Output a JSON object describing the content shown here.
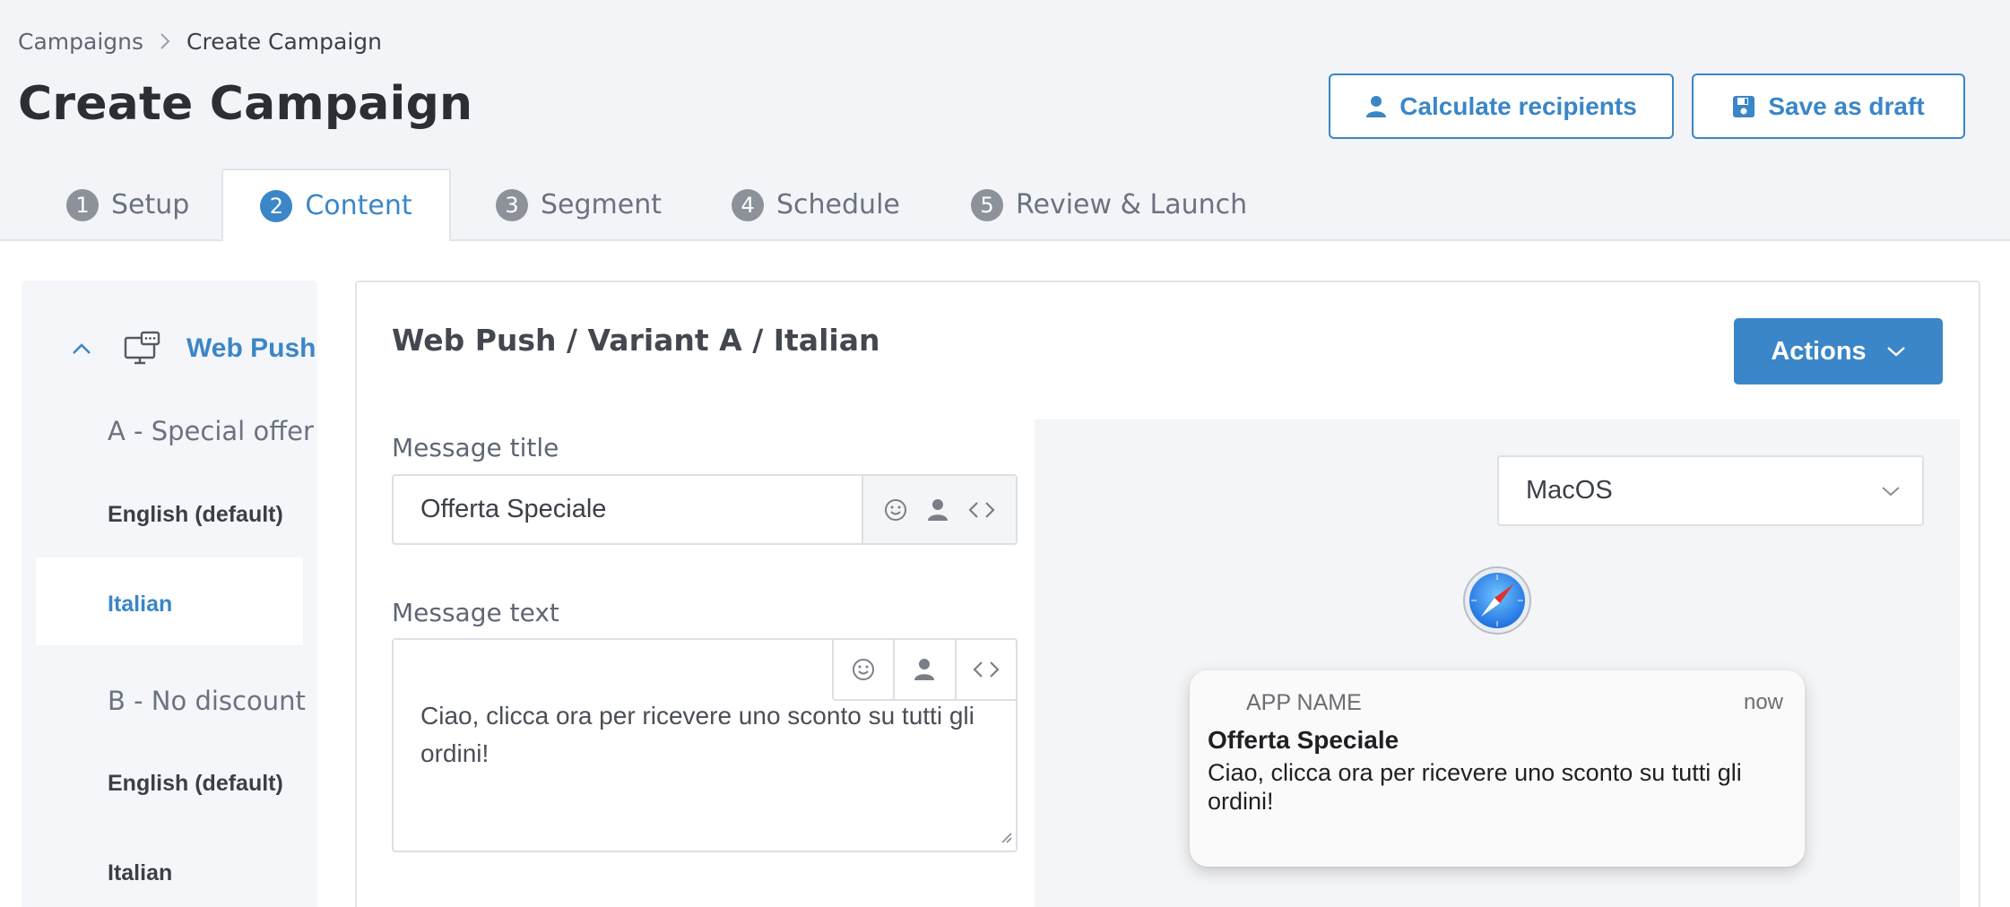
{
  "breadcrumb": {
    "parent": "Campaigns",
    "current": "Create Campaign"
  },
  "page_title": "Create Campaign",
  "header_buttons": {
    "calculate": "Calculate recipients",
    "save_draft": "Save as draft"
  },
  "tabs": [
    {
      "num": "1",
      "label": "Setup"
    },
    {
      "num": "2",
      "label": "Content",
      "active": true
    },
    {
      "num": "3",
      "label": "Segment"
    },
    {
      "num": "4",
      "label": "Schedule"
    },
    {
      "num": "5",
      "label": "Review & Launch"
    }
  ],
  "sidebar": {
    "channel": "Web Push",
    "variants": [
      {
        "name": "A - Special offer",
        "languages": [
          "English (default)",
          "Italian"
        ]
      },
      {
        "name": "B - No discount",
        "languages": [
          "English (default)",
          "Italian"
        ]
      }
    ],
    "active_language": "Italian"
  },
  "editor": {
    "path_title": "Web Push / Variant A / Italian",
    "actions_label": "Actions",
    "title_label": "Message title",
    "title_value": "Offerta Speciale",
    "text_label": "Message text",
    "text_value": "Ciao, clicca ora per ricevere uno sconto su tutti gli ordini!"
  },
  "preview": {
    "os_value": "MacOS",
    "app_name": "APP NAME",
    "time": "now",
    "notif_title": "Offerta Speciale",
    "notif_body": "Ciao, clicca ora per ricevere uno sconto su tutti gli ordini!"
  },
  "colors": {
    "accent": "#3a86c8",
    "tab_inactive": "#8d9199",
    "page_bg": "#f3f4f7"
  },
  "icons": [
    "chevron-right-icon",
    "user-icon",
    "floppy-disk-icon",
    "chevron-up-icon",
    "desktop-chat-icon",
    "emoji-icon",
    "code-icon",
    "chevron-down-icon",
    "safari-icon"
  ]
}
